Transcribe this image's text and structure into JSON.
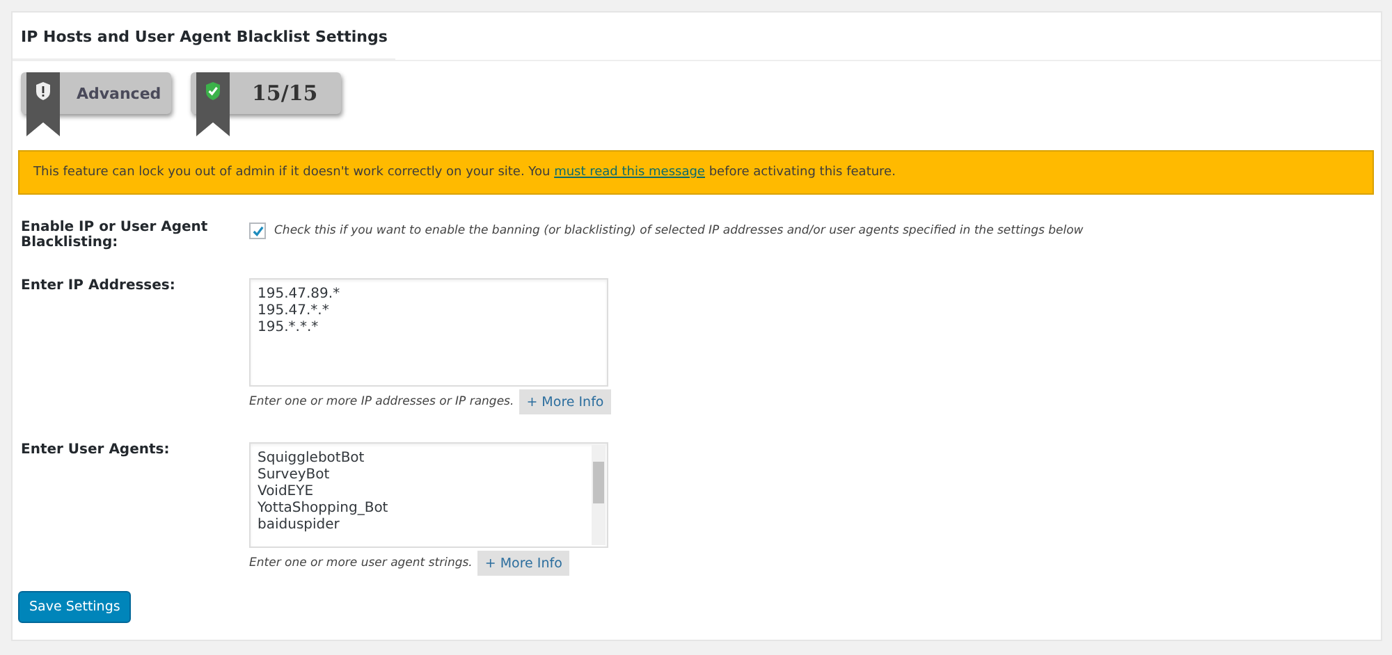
{
  "panel": {
    "title": "IP Hosts and User Agent Blacklist Settings"
  },
  "badges": [
    {
      "kind": "shield",
      "label": "Advanced"
    },
    {
      "kind": "check",
      "label": "15/15"
    }
  ],
  "notice": {
    "text_before": "This feature can lock you out of admin if it doesn't work correctly on your site. You ",
    "link": "must read this message",
    "text_after": " before activating this feature."
  },
  "enable": {
    "label": "Enable IP or User Agent Blacklisting:",
    "checked": true,
    "description": "Check this if you want to enable the banning (or blacklisting) of selected IP addresses and/or user agents specified in the settings below"
  },
  "ip_addresses": {
    "label": "Enter IP Addresses:",
    "lines": [
      "195.47.89.*",
      "195.47.*.*",
      "195.*.*.*"
    ],
    "help": "Enter one or more IP addresses or IP ranges.",
    "more_info": "+ More Info"
  },
  "user_agents": {
    "label": "Enter User Agents:",
    "lines": [
      "SquigglebotBot",
      "SurveyBot",
      "VoidEYE",
      "YottaShopping_Bot",
      "baiduspider"
    ],
    "help": "Enter one or more user agent strings.",
    "more_info": "+ More Info"
  },
  "save_button": "Save Settings"
}
